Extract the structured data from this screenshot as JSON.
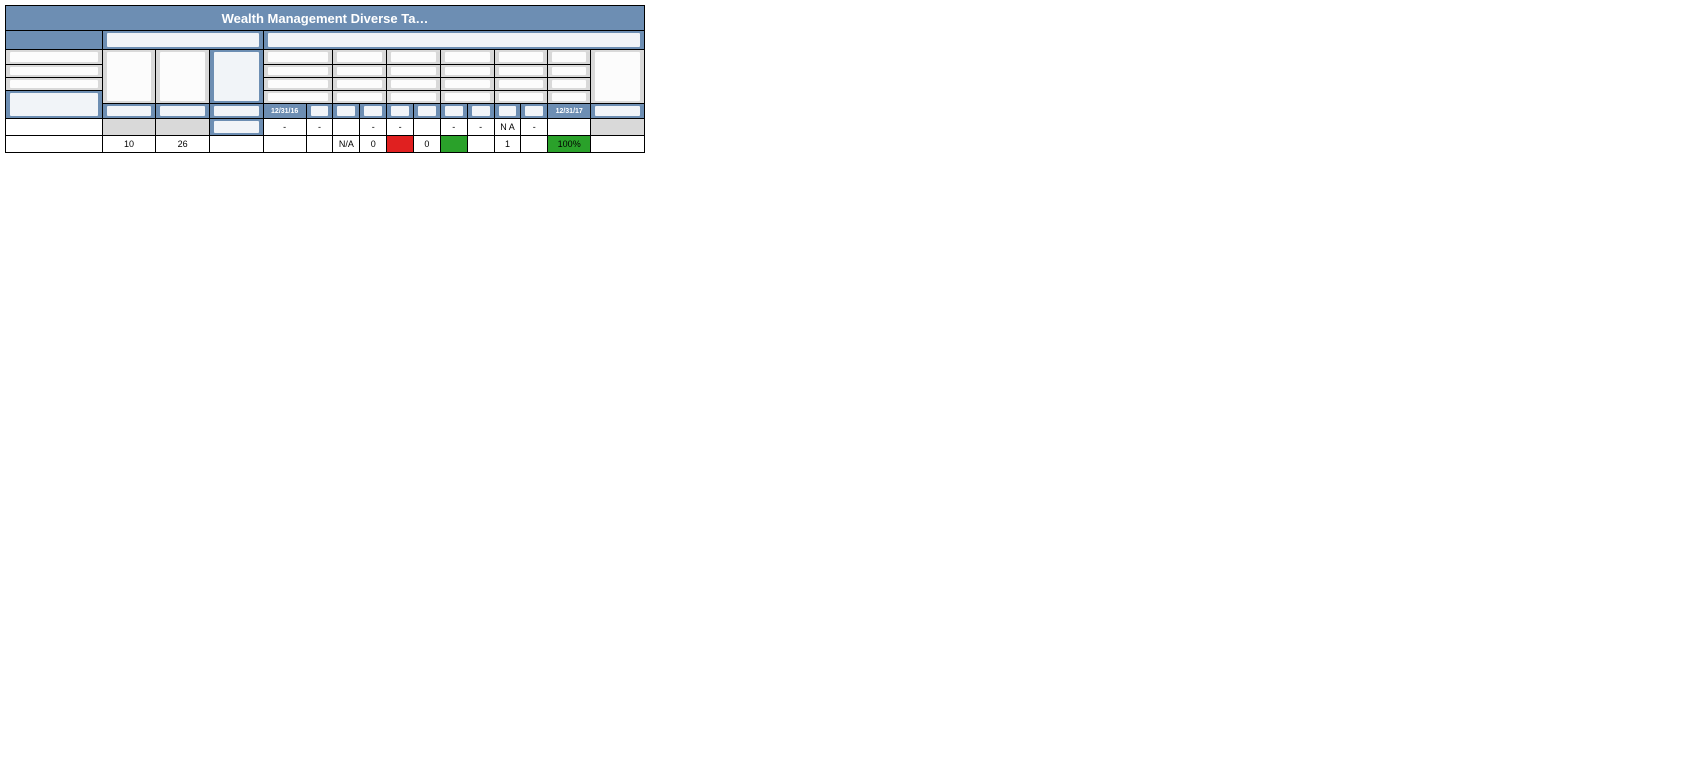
{
  "title": "Wealth Management Diverse Ta…",
  "section_left_header": "",
  "section_right_header": "",
  "left_block": {
    "rows": [
      {
        "a": "",
        "b": ""
      },
      {
        "a": "",
        "b": ""
      },
      {
        "a": "",
        "b": ""
      }
    ],
    "footer_label": ""
  },
  "mid_block": {
    "col1": "",
    "col2": "",
    "col3": ""
  },
  "right_block": {
    "group_headers": [
      "",
      "",
      "",
      "",
      "",
      "",
      ""
    ],
    "sub_rows": [
      [
        "",
        "",
        "",
        "",
        "",
        "",
        ""
      ],
      [
        "",
        "",
        "",
        "",
        "",
        "",
        ""
      ],
      [
        "",
        "",
        "",
        "",
        "",
        "",
        ""
      ]
    ],
    "date_left": "12/31/16",
    "date_right": "12/31/17",
    "mini_headers": [
      "",
      "",
      "",
      "",
      "",
      "",
      "",
      "",
      "",
      "",
      "",
      ""
    ]
  },
  "data_rows": [
    {
      "name": "",
      "mid": [
        "",
        "",
        ""
      ],
      "cells": [
        "-",
        "-",
        "",
        "-",
        "-",
        "",
        "-",
        "-",
        "N A",
        "-",
        "",
        ""
      ],
      "colors": [
        "",
        "",
        "",
        "",
        "",
        "",
        "",
        "",
        "",
        "",
        "",
        "grey"
      ]
    },
    {
      "name": "",
      "mid": [
        "10",
        "26",
        ""
      ],
      "cells": [
        "",
        "",
        "N/A",
        "0",
        "",
        "0",
        "",
        "",
        "1",
        "",
        "100%",
        ""
      ],
      "colors": [
        "",
        "",
        "",
        "",
        "red",
        "",
        "green",
        "",
        "",
        "",
        "green",
        ""
      ]
    }
  ],
  "colors": {
    "header": "#6d8eb3",
    "grey": "#d9d9d9",
    "green": "#2aa12a",
    "red": "#e02020"
  }
}
